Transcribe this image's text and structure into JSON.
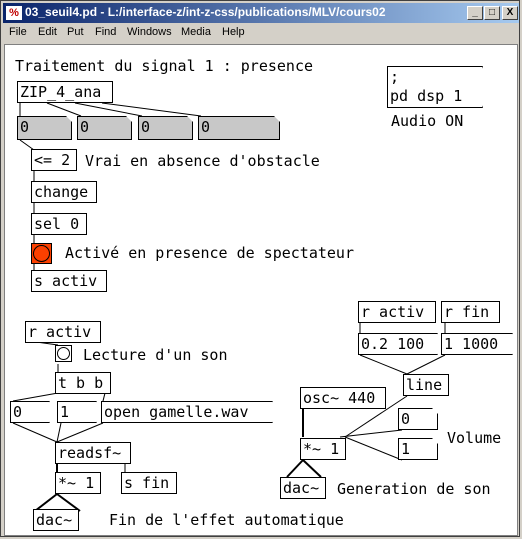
{
  "window": {
    "icon": "%",
    "title": "03_seuil4.pd  -  L:/interface-z/int-z-css/publications/MLV/cours02",
    "minimize": "_",
    "maximize": "□",
    "close": "X"
  },
  "menu": [
    "File",
    "Edit",
    "Put",
    "Find",
    "Windows",
    "Media",
    "Help"
  ],
  "patch": {
    "comments": {
      "title": "Traitement du signal 1 : presence",
      "audio_on": "Audio ON",
      "vrai": "Vrai en absence d'obstacle",
      "active": "Activé en presence de spectateur",
      "lecture": "Lecture d'un son",
      "volume": "Volume",
      "generation": "Generation de son",
      "fin": "Fin de l'effet automatique"
    },
    "objects": {
      "zip": "ZIP_4_ana",
      "lte": "<= 2",
      "change": "change",
      "sel": "sel 0",
      "s_activ": "s activ",
      "r_activ_left": "r activ",
      "tbb": "t b b",
      "readsf": "readsf~",
      "mul_left": "*~ 1",
      "s_fin": "s fin",
      "dac_left": "dac~",
      "r_activ_right": "r activ",
      "r_fin": "r fin",
      "line": "line",
      "osc": "osc~ 440",
      "mul_right": "*~ 1",
      "dac_right": "dac~"
    },
    "messages": {
      "dsp_line1": ";",
      "dsp_line2": "pd dsp 1",
      "zero": "0",
      "one": "1",
      "open": "open gamelle.wav",
      "ramp_on": "0.2 100",
      "ramp_off": "1 1000"
    },
    "atoms": {
      "ana1": "0",
      "ana2": "0",
      "ana3": "0",
      "ana4": "0",
      "vol0": "0",
      "vol1": "1"
    },
    "colors": {
      "bang_active": "#fc4000",
      "atom_grey": "#c8c8c8",
      "titlebar": "#0a246a"
    }
  }
}
